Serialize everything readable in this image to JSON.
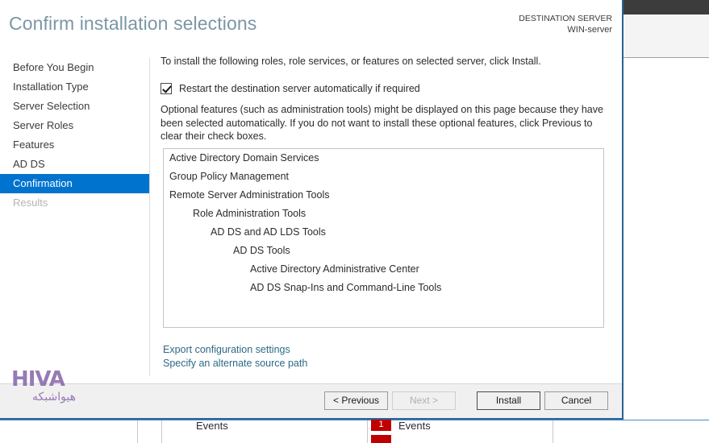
{
  "dialog": {
    "title": "Confirm installation selections",
    "destination": {
      "caption": "DESTINATION SERVER",
      "server_name": "WIN-server"
    }
  },
  "sidebar": {
    "items": [
      {
        "label": "Before You Begin",
        "state": "normal"
      },
      {
        "label": "Installation Type",
        "state": "normal"
      },
      {
        "label": "Server Selection",
        "state": "normal"
      },
      {
        "label": "Server Roles",
        "state": "normal"
      },
      {
        "label": "Features",
        "state": "normal"
      },
      {
        "label": "AD DS",
        "state": "normal"
      },
      {
        "label": "Confirmation",
        "state": "selected"
      },
      {
        "label": "Results",
        "state": "disabled"
      }
    ],
    "selected_color": "#0073cf"
  },
  "content": {
    "intro": "To install the following roles, role services, or features on selected server, click Install.",
    "restart_checkbox": {
      "label": "Restart the destination server automatically if required",
      "checked": true
    },
    "optional_note": "Optional features (such as administration tools) might be displayed on this page because they have been selected automatically. If you do not want to install these optional features, click Previous to clear their check boxes.",
    "selections": [
      {
        "label": "Active Directory Domain Services",
        "level": 0
      },
      {
        "label": "Group Policy Management",
        "level": 0
      },
      {
        "label": "Remote Server Administration Tools",
        "level": 0
      },
      {
        "label": "Role Administration Tools",
        "level": 1
      },
      {
        "label": "AD DS and AD LDS Tools",
        "level": 2
      },
      {
        "label": "AD DS Tools",
        "level": 3
      },
      {
        "label": "Active Directory Administrative Center",
        "level": 4
      },
      {
        "label": "AD DS Snap-Ins and Command-Line Tools",
        "level": 4
      }
    ],
    "links": [
      {
        "label": "Export configuration settings"
      },
      {
        "label": "Specify an alternate source path"
      }
    ],
    "link_color": "#2d6a86"
  },
  "footer": {
    "buttons": [
      {
        "label": "< Previous",
        "state": "enabled"
      },
      {
        "label": "Next >",
        "state": "disabled"
      },
      {
        "label": "Install",
        "state": "focused"
      },
      {
        "label": "Cancel",
        "state": "enabled"
      }
    ]
  },
  "background": {
    "tiles": [
      {
        "label": "Events",
        "badge": ""
      },
      {
        "label": "Events",
        "badge": "1"
      }
    ],
    "badge_color": "#c00000"
  },
  "watermark": {
    "brand": "HIVA",
    "brand_fa": "هیواشبکه",
    "color": "#8f6fb0"
  }
}
